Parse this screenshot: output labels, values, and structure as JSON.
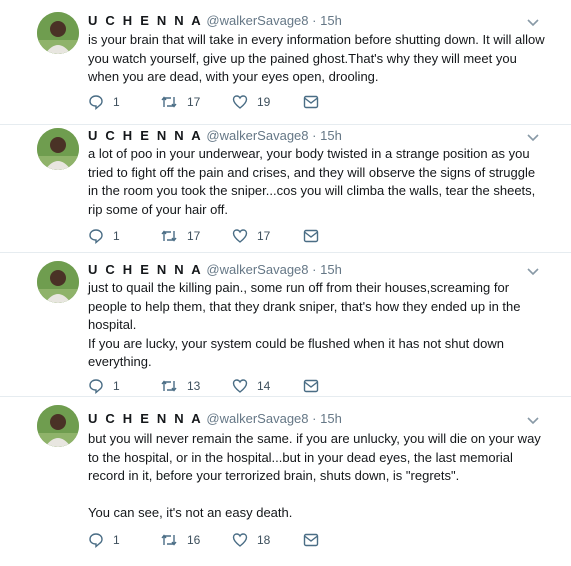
{
  "tweets": [
    {
      "name": "U C H E N N A",
      "handle": "@walkerSavage8",
      "time": "15h",
      "text": "is your brain that will take in every information before shutting down. It will allow you watch yourself, give up the pained ghost.That's why they will meet you when you are dead, with your eyes open, drooling.",
      "replies": "1",
      "retweets": "17",
      "likes": "19"
    },
    {
      "name": "U C H E N N A",
      "handle": "@walkerSavage8",
      "time": "15h",
      "text": "a lot of poo in your underwear, your body twisted in a strange position as you tried to fight off the pain and crises, and they will observe the signs of struggle in the room you took the sniper...cos you will climba the walls, tear the sheets, rip some of your hair off.",
      "replies": "1",
      "retweets": "17",
      "likes": "17"
    },
    {
      "name": "U C H E N N A",
      "handle": "@walkerSavage8",
      "time": "15h",
      "text": "just to quail the killing pain., some run off from their houses,screaming for people to help them, that they drank sniper, that's how they ended up in the hospital.\nIf you are lucky, your system could be flushed when it has not shut down everything.",
      "replies": "1",
      "retweets": "13",
      "likes": "14"
    },
    {
      "name": "U C H E N N A",
      "handle": "@walkerSavage8",
      "time": "15h",
      "text": "but you will never remain the same. if you are unlucky, you will die on your way to the hospital, or in the hospital...but in your dead eyes, the last memorial record in it, before your terrorized brain, shuts down, is \"regrets\".\n\nYou can see, it's not an easy death.",
      "replies": "1",
      "retweets": "16",
      "likes": "18"
    }
  ],
  "icons": {
    "reply": "reply-icon",
    "retweet": "retweet-icon",
    "like": "heart-icon",
    "message": "direct-message-icon",
    "menu": "chevron-down-icon"
  },
  "colors": {
    "icon": "#4a6d85",
    "meta": "#657786",
    "text": "#14171a"
  }
}
